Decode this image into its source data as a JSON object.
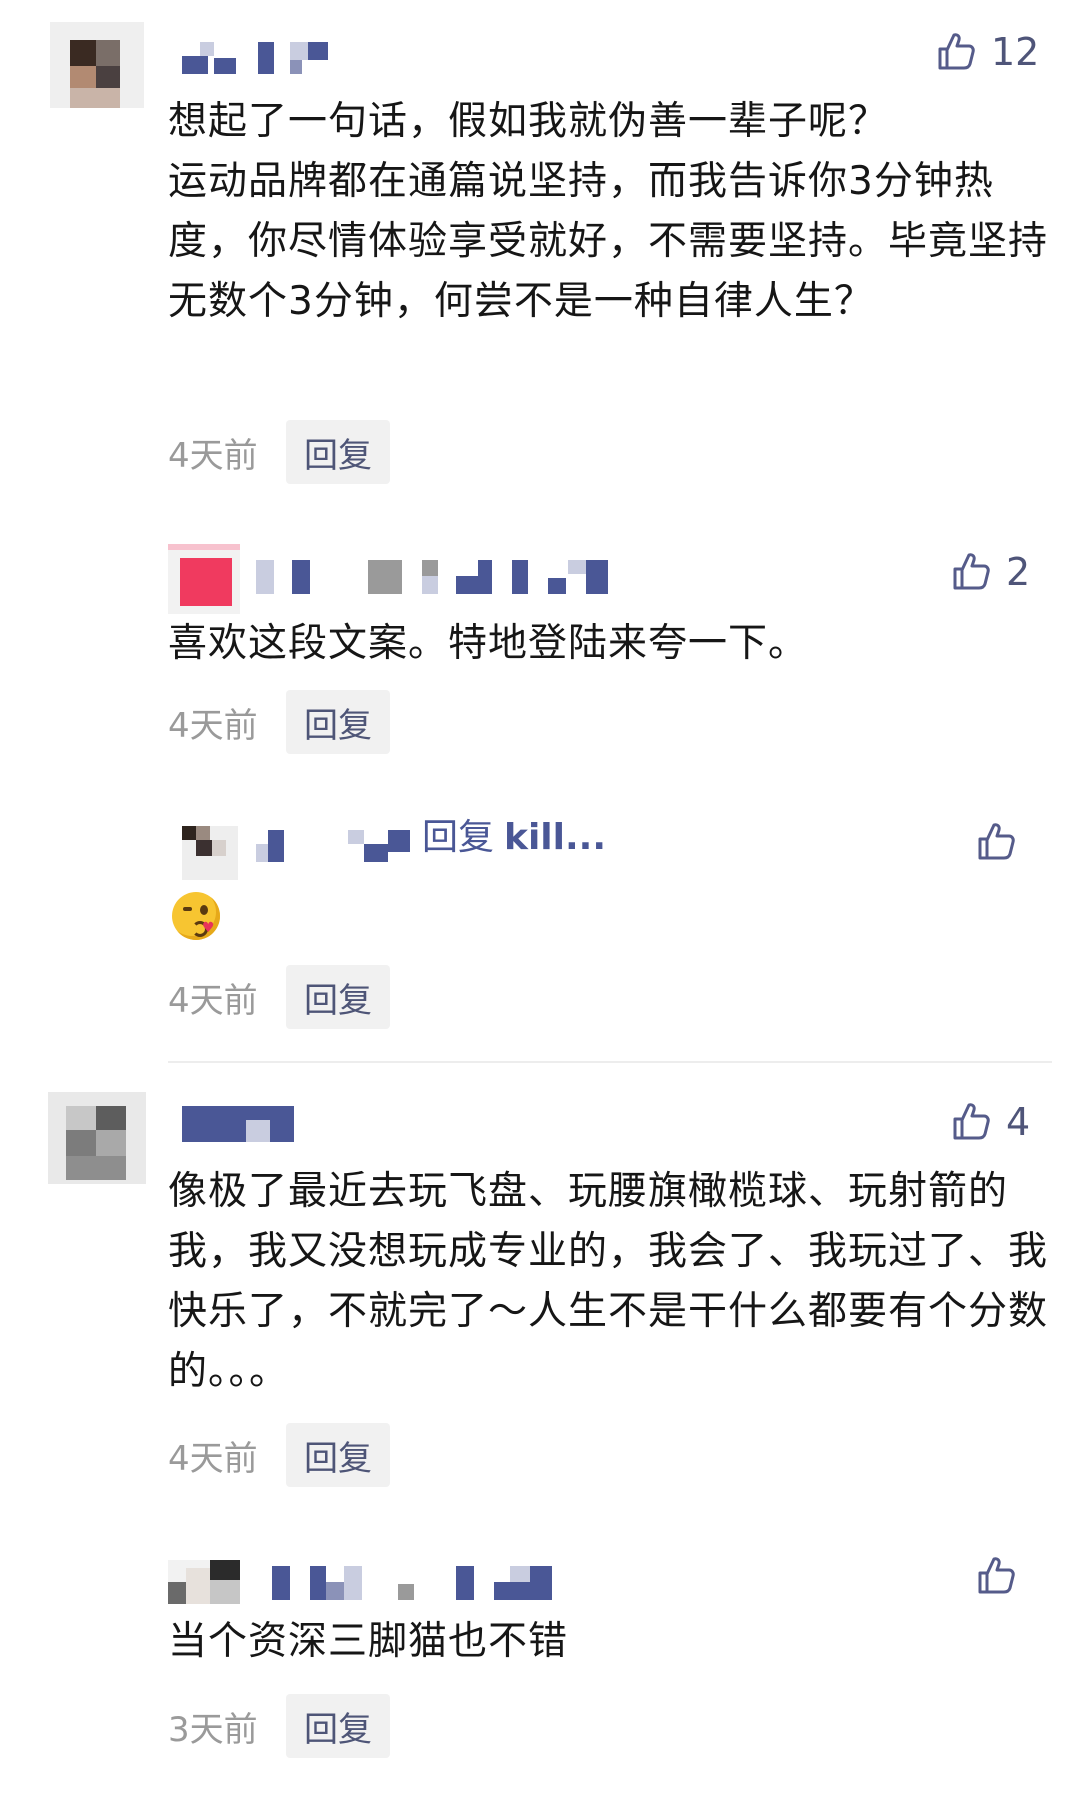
{
  "icons": {
    "like": "thumbs-up-icon",
    "emoji": "kissing-face-emoji"
  },
  "colors": {
    "accent": "#4a5796",
    "meta": "#9a9a9a",
    "reply_bg": "#f1f1f1"
  },
  "comments": [
    {
      "likes": "12",
      "text": "想起了一句话，假如我就伪善一辈子呢？\n运动品牌都在通篇说坚持，而我告诉你3分钟热度，你尽情体验享受就好，不需要坚持。毕竟坚持无数个3分钟，何尝不是一种自律人生？",
      "time": "4天前",
      "reply_label": "回复"
    },
    {
      "likes": "2",
      "text": "喜欢这段文案。特地登陆来夸一下。",
      "time": "4天前",
      "reply_label": "回复"
    },
    {
      "likes": "",
      "reply_to_label": "回复",
      "reply_to_target": "kill...",
      "time": "4天前",
      "reply_label": "回复"
    },
    {
      "likes": "4",
      "text": "像极了最近去玩飞盘、玩腰旗橄榄球、玩射箭的我，我又没想玩成专业的，我会了、我玩过了、我快乐了，不就完了～人生不是干什么都要有个分数的。。。",
      "time": "4天前",
      "reply_label": "回复"
    },
    {
      "likes": "",
      "text": "当个资深三脚猫也不错",
      "time": "3天前",
      "reply_label": "回复"
    }
  ]
}
